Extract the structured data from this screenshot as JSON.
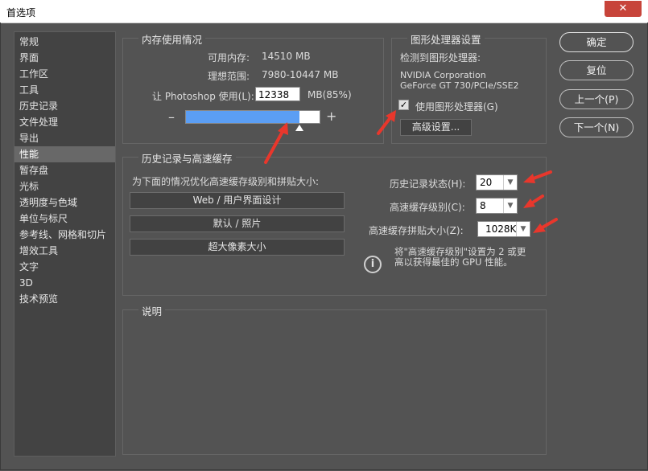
{
  "window": {
    "title": "首选项",
    "close": "✕"
  },
  "sidebar": {
    "items": [
      "常规",
      "界面",
      "工作区",
      "工具",
      "历史记录",
      "文件处理",
      "导出",
      "性能",
      "暂存盘",
      "光标",
      "透明度与色域",
      "单位与标尺",
      "参考线、网格和切片",
      "增效工具",
      "文字",
      "3D",
      "技术预览"
    ],
    "selected_index": 7
  },
  "memory": {
    "legend": "内存使用情况",
    "available_label": "可用内存:",
    "available_value": "14510 MB",
    "ideal_label": "理想范围:",
    "ideal_value": "7980-10447 MB",
    "let_label": "让 Photoshop 使用(L):",
    "let_value": "12338",
    "let_unit": "MB(85%)",
    "minus": "–",
    "plus": "+",
    "slider_fraction": 0.85
  },
  "gpu": {
    "legend": "图形处理器设置",
    "detected_label": "检测到图形处理器:",
    "vendor": "NVIDIA Corporation",
    "model": "GeForce GT 730/PCIe/SSE2",
    "use_gpu_label": "使用图形处理器(G)",
    "use_gpu_checked": true,
    "check_glyph": "✓",
    "advanced_label": "高级设置..."
  },
  "history": {
    "legend": "历史记录与高速缓存",
    "optimize_label": "为下面的情况优化高速缓存级别和拼贴大小:",
    "buttons": [
      "Web / 用户界面设计",
      "默认 / 照片",
      "超大像素大小"
    ],
    "history_states_label": "历史记录状态(H):",
    "history_states_value": "20",
    "cache_levels_label": "高速缓存级别(C):",
    "cache_levels_value": "8",
    "tile_size_label": "高速缓存拼贴大小(Z):",
    "tile_size_value": "1028K",
    "info_icon": "i",
    "info_line1": "将\"高速缓存级别\"设置为 2 或更",
    "info_line2": "高以获得最佳的 GPU 性能。"
  },
  "description": {
    "legend": "说明"
  },
  "actions": {
    "ok": "确定",
    "reset": "复位",
    "prev": "上一个(P)",
    "next": "下一个(N)"
  },
  "colors": {
    "background": "#535353",
    "slider_fill": "#5b9ef4",
    "annotation_arrow": "#e8372c",
    "selection": "#686868"
  }
}
